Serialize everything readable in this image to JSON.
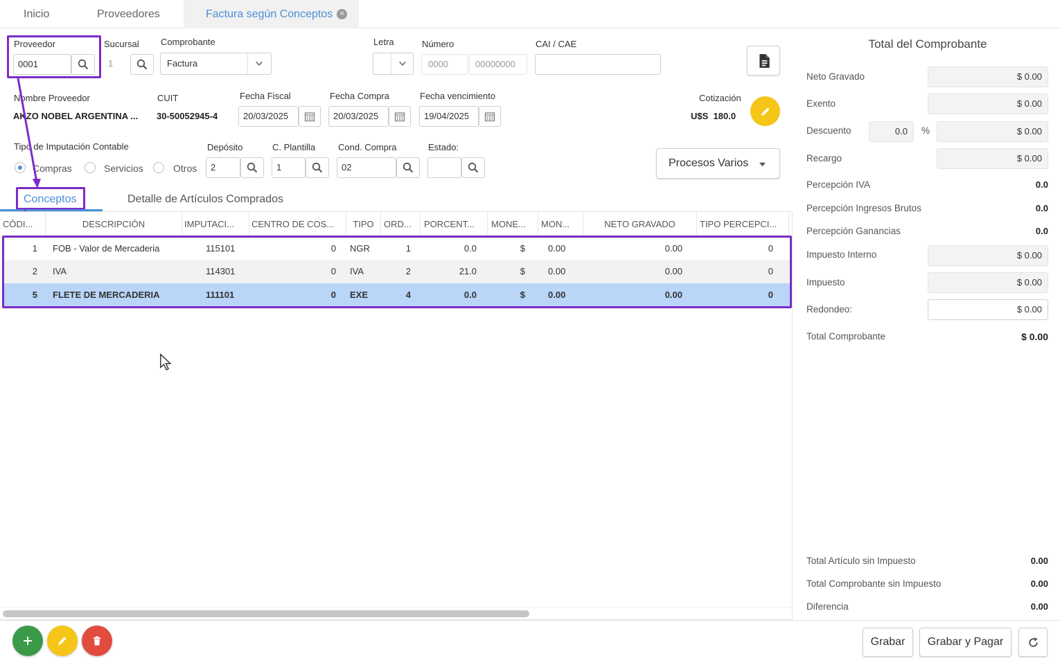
{
  "tabs": {
    "inicio": "Inicio",
    "proveedores": "Proveedores",
    "factura": "Factura según Conceptos",
    "close_glyph": "×"
  },
  "header": {
    "proveedor_label": "Proveedor",
    "proveedor_value": "0001",
    "sucursal_label": "Sucursal",
    "sucursal_value": "1",
    "comprobante_label": "Comprobante",
    "comprobante_value": "Factura",
    "letra_label": "Letra",
    "letra_value": "",
    "numero_label": "Número",
    "numero_punto": "0000",
    "numero_nro": "00000000",
    "cai_label": "CAI / CAE",
    "cai_value": "",
    "nombre_label": "Nombre Proveedor",
    "nombre_value": "AKZO NOBEL ARGENTINA ...",
    "cuit_label": "CUIT",
    "cuit_value": "30-50052945-4",
    "fecha_fiscal_label": "Fecha Fiscal",
    "fecha_fiscal_value": "20/03/2025",
    "fecha_compra_label": "Fecha Compra",
    "fecha_compra_value": "20/03/2025",
    "fecha_venc_label": "Fecha vencimiento",
    "fecha_venc_value": "19/04/2025",
    "cotizacion_label": "Cotización",
    "cotizacion_value": "U$S  180.0",
    "imputacion_label": "Tipo de Imputación Contable",
    "radio_compras": "Compras",
    "radio_servicios": "Servicios",
    "radio_otros": "Otros",
    "deposito_label": "Depósito",
    "deposito_value": "2",
    "plantilla_label": "C. Plantilla",
    "plantilla_value": "1",
    "cond_label": "Cond. Compra",
    "cond_value": "02",
    "estado_label": "Estado:",
    "estado_value": "",
    "procesos_label": "Procesos Varios"
  },
  "subtabs": {
    "conceptos": "Conceptos",
    "detalle": "Detalle de Artículos Comprados"
  },
  "grid": {
    "headers": [
      "CÓDI...",
      "DESCRIPCIÓN",
      "IMPUTACI...",
      "CENTRO DE COS...",
      "TIPO",
      "ORD...",
      "PORCENT...",
      "MONE...",
      "MON...",
      "NETO GRAVADO",
      "TIPO PERCEPCI..."
    ],
    "rows": [
      [
        "1",
        "FOB - Valor de Mercaderia",
        "115101",
        "0",
        "NGR",
        "1",
        "0.0",
        "$",
        "0.00",
        "0.00",
        "0"
      ],
      [
        "2",
        "IVA",
        "114301",
        "0",
        "IVA",
        "2",
        "21.0",
        "$",
        "0.00",
        "0.00",
        "0"
      ],
      [
        "5",
        "FLETE DE MERCADERIA",
        "111101",
        "0",
        "EXE",
        "4",
        "0.0",
        "$",
        "0.00",
        "0.00",
        "0"
      ]
    ]
  },
  "totals": {
    "title": "Total del Comprobante",
    "neto_label": "Neto Gravado",
    "neto_value": "$ 0.00",
    "exento_label": "Exento",
    "exento_value": "$ 0.00",
    "descuento_label": "Descuento",
    "descuento_pct": "0.0",
    "pct_sign": "%",
    "descuento_value": "$ 0.00",
    "recargo_label": "Recargo",
    "recargo_value": "$ 0.00",
    "perc_iva_label": "Percepción IVA",
    "perc_iva_value": "0.0",
    "perc_iibb_label": "Percepción Ingresos Brutos",
    "perc_iibb_value": "0.0",
    "perc_gan_label": "Percepción Ganancias",
    "perc_gan_value": "0.0",
    "imp_int_label": "Impuesto Interno",
    "imp_int_value": "$ 0.00",
    "impuesto_label": "Impuesto",
    "impuesto_value": "$ 0.00",
    "redondeo_label": "Redondeo:",
    "redondeo_value": "$ 0.00",
    "total_label": "Total Comprobante",
    "total_value": "$ 0.00",
    "art_sin_imp_label": "Total Artículo sin Impuesto",
    "art_sin_imp_value": "0.00",
    "comp_sin_imp_label": "Total Comprobante sin Impuesto",
    "comp_sin_imp_value": "0.00",
    "diferencia_label": "Diferencia",
    "diferencia_value": "0.00"
  },
  "footer": {
    "grabar": "Grabar",
    "grabar_pagar": "Grabar y Pagar"
  },
  "colors": {
    "accent_blue": "#4a8fd8",
    "highlight_purple": "#7b2cc7",
    "selected_row": "#b9d5f7",
    "fab_green": "#3a9a4a",
    "fab_yellow": "#f5c518",
    "fab_red": "#e24c3f"
  }
}
